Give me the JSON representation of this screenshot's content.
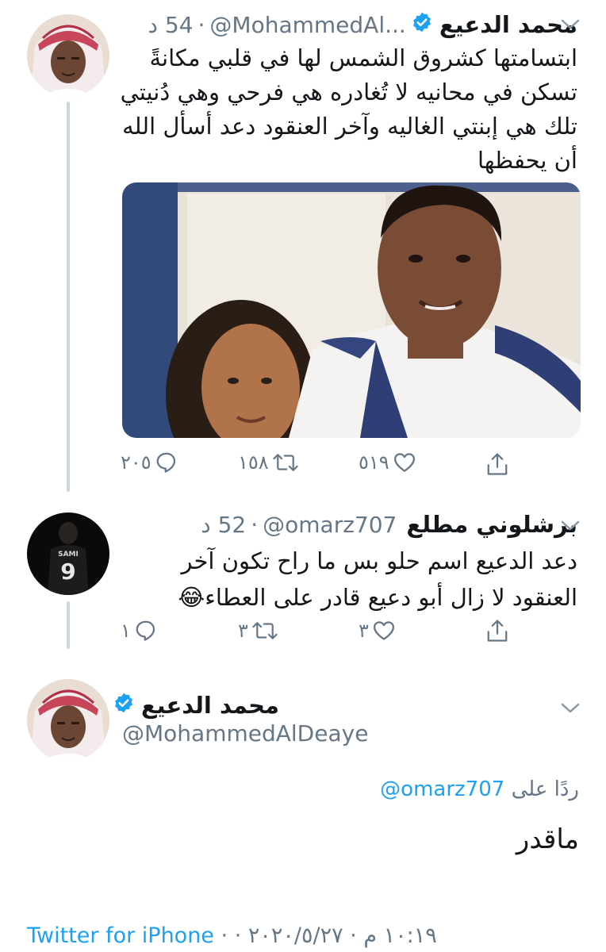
{
  "tweets": [
    {
      "name": "محمد الدعيع",
      "handle": "@MohammedAl...",
      "time": "54 د",
      "separator": "·",
      "text_lines": [
        "ابتسامتها كشروق الشمس لها في قلبي مكانةً",
        "تسكن في محانيه لا تُغادره هي فرحي وهي دُنيتي",
        "تلك هي إبنتي الغاليه وآخر العنقود دعد أسأل الله",
        "أن يحفظها"
      ],
      "actions": {
        "replies": "٢٠٥",
        "retweets": "١٥٨",
        "likes": "٥١٩"
      }
    },
    {
      "name": "برشلوني مطلع",
      "handle": "@omarz707",
      "time": "52 د",
      "separator": "·",
      "avatar_jersey_name": "SAMI",
      "avatar_jersey_number": "9",
      "text_lines": [
        "دعد الدعيع اسم حلو بس ما راح تكون آخر",
        "العنقود لا زال أبو دعيع قادر على العطاء"
      ],
      "emoji": "😂",
      "actions": {
        "replies": "١",
        "retweets": "٣",
        "likes": "٣"
      }
    }
  ],
  "main_tweet": {
    "name": "محمد الدعيع",
    "handle": "@MohammedAlDeaye",
    "reply_prefix": "ردًا على",
    "reply_handle": "@omarz707",
    "text": "ماقدر",
    "timestamp": "١٠:١٩ م · ٢٠٢٠/٥/٢٧ ·",
    "source": "Twitter for iPhone"
  },
  "icons": {
    "reply": "reply-icon",
    "retweet": "retweet-icon",
    "like": "heart-icon",
    "share": "share-icon",
    "verified": "verified-badge-icon",
    "more": "chevron-down-icon"
  },
  "colors": {
    "text": "#14171a",
    "secondary": "#657786",
    "link": "#1da1f2",
    "verified": "#1da1f2",
    "thread_line": "#ccd6dd"
  }
}
